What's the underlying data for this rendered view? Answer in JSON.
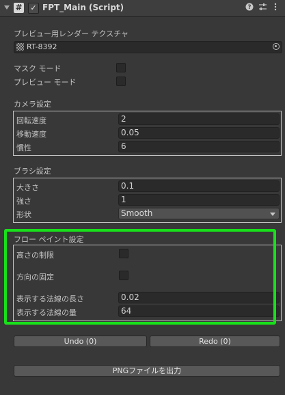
{
  "header": {
    "title": "FPT_Main (Script)",
    "script_icon": "#",
    "enabled_check": "✓",
    "icons": [
      "help-icon",
      "preset-icon",
      "more-menu-icon"
    ]
  },
  "render_texture": {
    "label": "プレビュー用レンダー テクスチャ",
    "value": "RT-8392"
  },
  "mask_mode": {
    "label": "マスク モード",
    "checked": false
  },
  "preview_mode": {
    "label": "プレビュー モード",
    "checked": false
  },
  "camera": {
    "header": "カメラ設定",
    "rotation_speed": {
      "label": "回転速度",
      "value": "2"
    },
    "move_speed": {
      "label": "移動速度",
      "value": "0.05"
    },
    "inertia": {
      "label": "慣性",
      "value": "6"
    }
  },
  "brush": {
    "header": "ブラシ設定",
    "size": {
      "label": "大きさ",
      "value": "0.1"
    },
    "strength": {
      "label": "強さ",
      "value": "1"
    },
    "shape": {
      "label": "形状",
      "value": "Smooth"
    }
  },
  "flow_paint": {
    "header": "フロー ペイント設定",
    "height_limit": {
      "label": "高さの制限",
      "checked": false
    },
    "direction_lock": {
      "label": "方向の固定",
      "checked": false
    },
    "normal_length": {
      "label": "表示する法線の長さ",
      "value": "0.02"
    },
    "normal_count": {
      "label": "表示する法線の量",
      "value": "64"
    }
  },
  "actions": {
    "undo": "Undo (0)",
    "redo": "Redo (0)",
    "export_png": "PNGファイルを出力"
  },
  "colors": {
    "background": "#383838",
    "highlight": "#18e01a",
    "field_bg": "#2a2a2a",
    "button_bg": "#585858"
  }
}
